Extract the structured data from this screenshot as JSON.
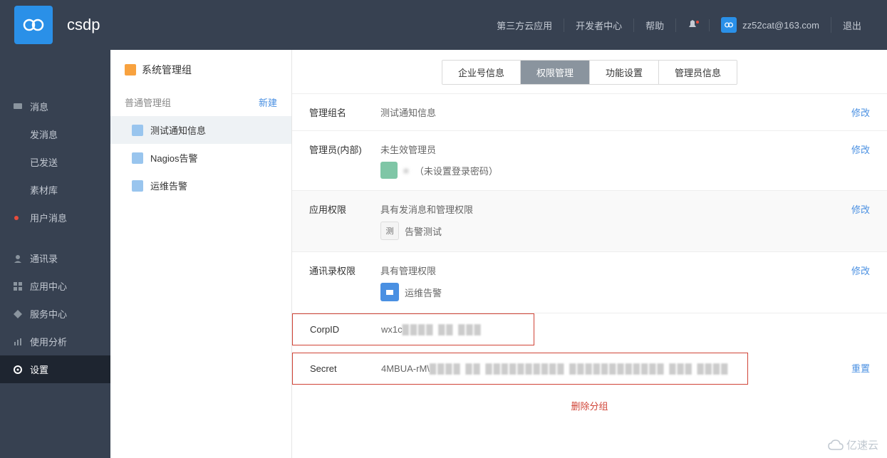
{
  "header": {
    "app_title": "csdp",
    "links": {
      "third_party": "第三方云应用",
      "dev_center": "开发者中心",
      "help": "帮助",
      "logout": "退出"
    },
    "user_email": "zz52cat@163.com"
  },
  "left_nav": {
    "messages": "消息",
    "send_msg": "发消息",
    "sent": "已发送",
    "materials": "素材库",
    "user_msg": "用户消息",
    "contacts": "通讯录",
    "app_center": "应用中心",
    "service_center": "服务中心",
    "analytics": "使用分析",
    "settings": "设置"
  },
  "second_panel": {
    "title": "系统管理组",
    "section_label": "普通管理组",
    "new_label": "新建",
    "items": {
      "0": "测试通知信息",
      "1": "Nagios告警",
      "2": "运维告警"
    }
  },
  "tabs": {
    "0": "企业号信息",
    "1": "权限管理",
    "2": "功能设置",
    "3": "管理员信息"
  },
  "detail": {
    "group_name_label": "管理组名",
    "group_name_value": "测试通知信息",
    "admin_label": "管理员(内部)",
    "admin_status": "未生效管理员",
    "admin_password_note": "（未设置登录密码）",
    "app_perm_label": "应用权限",
    "app_perm_value": "具有发消息和管理权限",
    "app_perm_item_icon": "测",
    "app_perm_item": "告警测试",
    "contact_perm_label": "通讯录权限",
    "contact_perm_value": "具有管理权限",
    "contact_perm_item": "运维告警",
    "corpid_label": "CorpID",
    "corpid_value": "wx1c",
    "secret_label": "Secret",
    "secret_value": "4MBUA-rM\\",
    "modify": "修改",
    "reset": "重置",
    "delete_group": "删除分组"
  },
  "watermark": "亿速云"
}
